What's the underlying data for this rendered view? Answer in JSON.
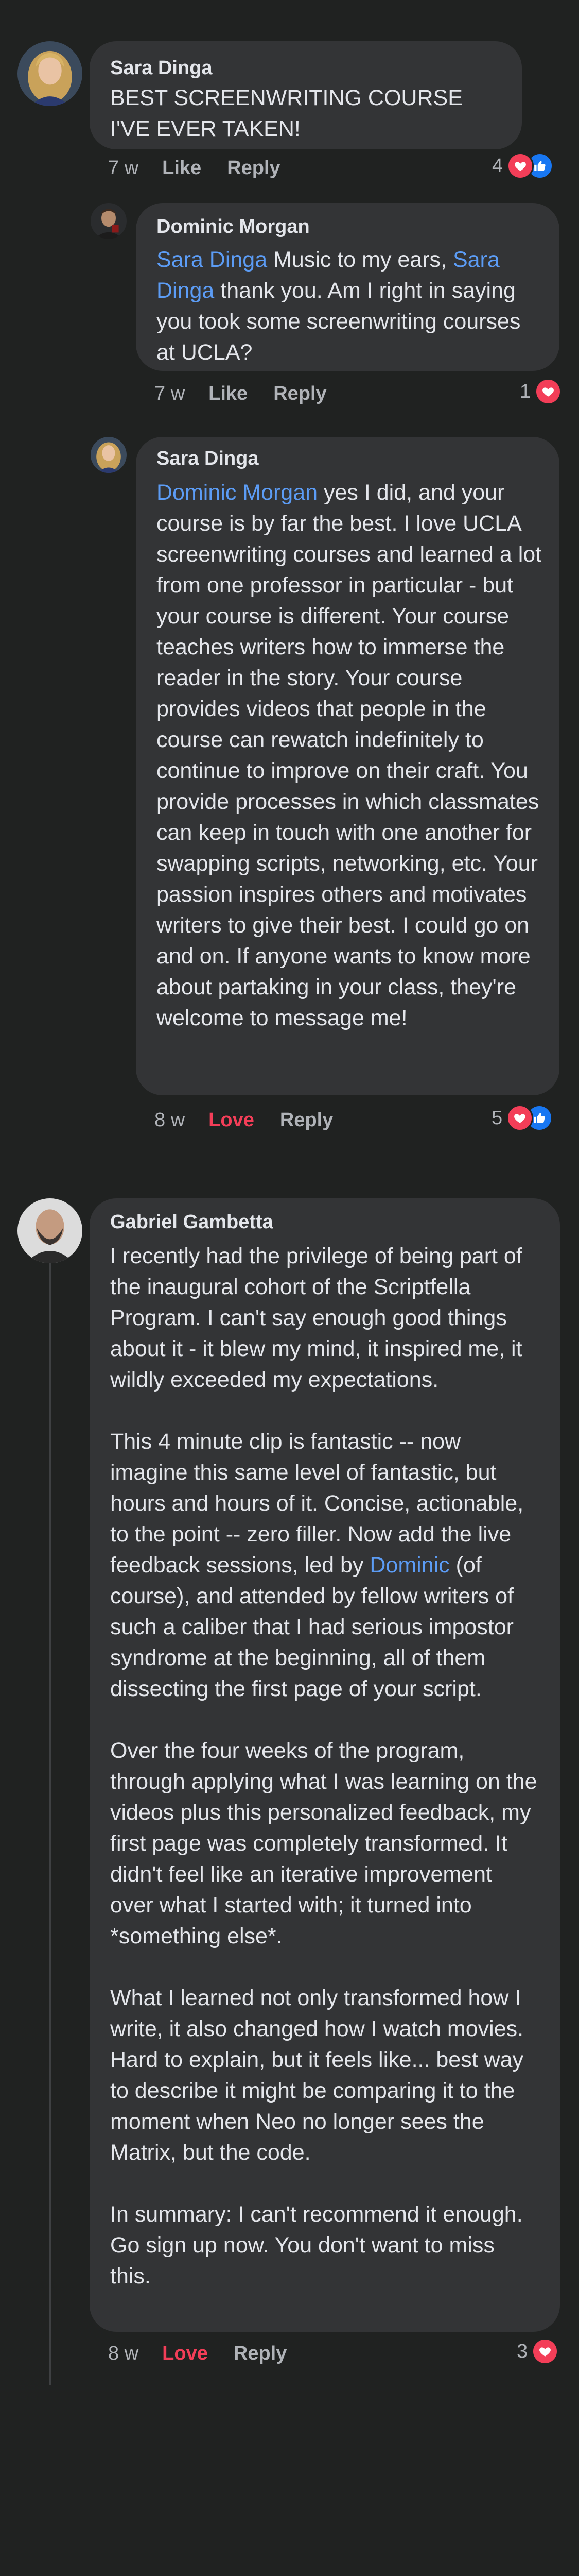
{
  "comments": [
    {
      "author": "Sara Dinga",
      "text": "BEST SCREENWRITING COURSE I'VE EVER TAKEN!",
      "time": "7 w",
      "like_label": "Like",
      "reply_label": "Reply",
      "reaction_count": "4",
      "reactions": [
        "heart-icon",
        "like-icon"
      ]
    },
    {
      "author": "Dominic Morgan",
      "mention_1": "Sara Dinga",
      "text_1": " Music to my ears, ",
      "mention_2": "Sara Dinga",
      "text_2": " thank you. Am I right in saying you took some screenwriting courses at UCLA?",
      "time": "7 w",
      "like_label": "Like",
      "reply_label": "Reply",
      "reaction_count": "1",
      "reactions": [
        "heart-icon"
      ]
    },
    {
      "author": "Sara Dinga",
      "mention_1": "Dominic Morgan",
      "text_1": " yes I did, and your course is by far the best. I love UCLA screenwriting courses and learned a lot from one professor in particular - but your course is different. Your course teaches writers how to immerse the reader in the story. Your course provides videos that people in the course can rewatch indefinitely to continue to improve on their craft. You provide processes in which classmates can keep in touch with one another for swapping scripts, networking, etc. Your passion inspires others and motivates writers to give their best. I could go on and on. If anyone wants to know more about partaking in your class, they're welcome to message me!",
      "time": "8 w",
      "like_label": "Love",
      "reply_label": "Reply",
      "reaction_count": "5",
      "reactions": [
        "heart-icon",
        "like-icon"
      ]
    },
    {
      "author": "Gabriel Gambetta",
      "text_1": "I recently had the privilege of being part of the inaugural cohort of the Scriptfella Program. I can't say enough good things about it - it blew my mind, it inspired me, it wildly exceeded my expectations.\n\nThis 4 minute clip is fantastic -- now imagine this same level of fantastic, but hours and hours of it. Concise, actionable, to the point -- zero filler. Now add the live feedback sessions, led by ",
      "mention_1": "Dominic",
      "text_2": " (of course), and attended by fellow writers of such a caliber that I had serious impostor syndrome at the beginning, all of them dissecting the first page of your script.\n\nOver the four weeks of the program, through applying what I was learning on the videos plus this personalized feedback, my first page was completely transformed. It didn't feel like an iterative improvement over what I started with; it turned into *something else*.\n\nWhat I learned not only transformed how I write, it also changed how I watch movies. Hard to explain, but it feels like... best way to describe it might be comparing it to the moment when Neo no longer sees the Matrix, but the code.\n\nIn summary: I can't recommend it enough. Go sign up now. You don't want to miss this.",
      "time": "8 w",
      "like_label": "Love",
      "reply_label": "Reply",
      "reaction_count": "3",
      "reactions": [
        "heart-icon"
      ]
    }
  ],
  "colors": {
    "background": "#202221",
    "bubble": "#333436",
    "mention": "#5c9cf5",
    "love": "#f33e58",
    "like": "#1877f2"
  }
}
